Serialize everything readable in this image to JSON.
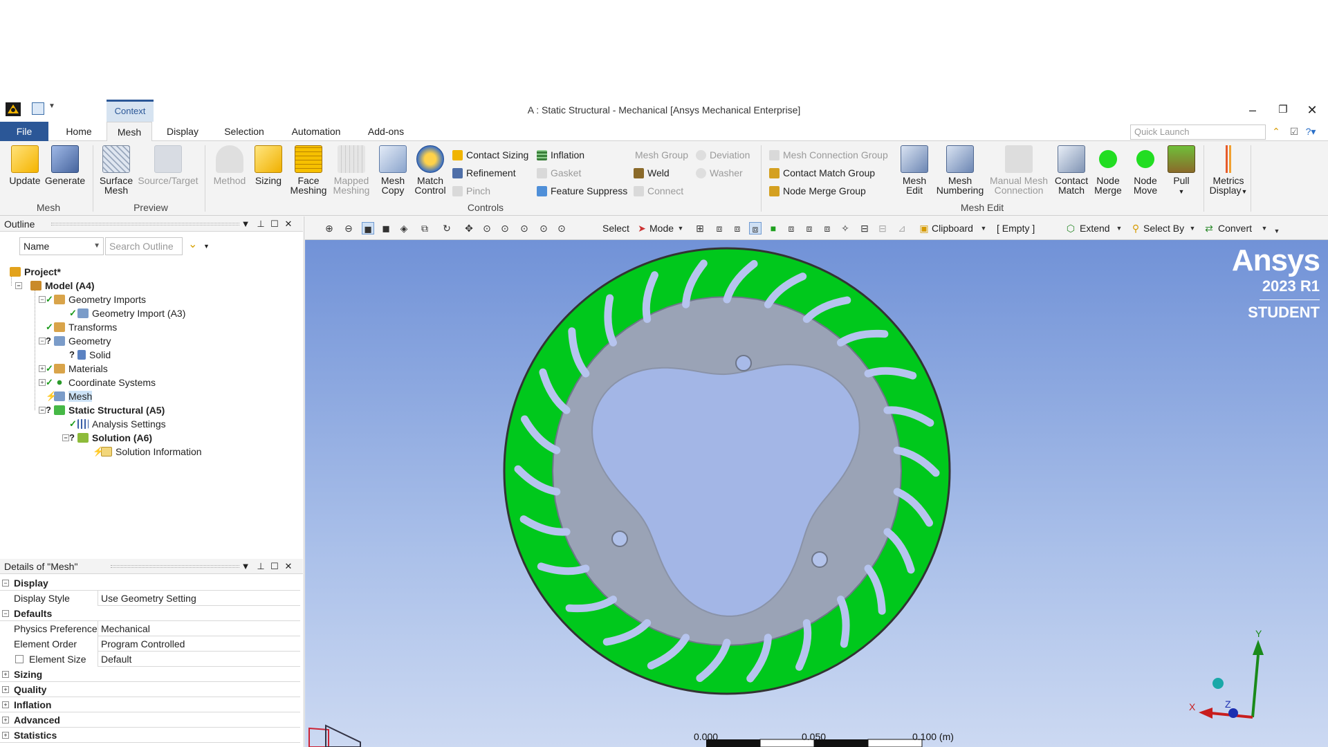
{
  "window": {
    "title": "A : Static Structural - Mechanical [Ansys Mechanical Enterprise]",
    "context_tab": "Context"
  },
  "tabs": {
    "file": "File",
    "items": [
      "Home",
      "Mesh",
      "Display",
      "Selection",
      "Automation",
      "Add-ons"
    ],
    "active": "Mesh",
    "quick_launch_placeholder": "Quick Launch"
  },
  "ribbon": {
    "update": "Update",
    "generate": "Generate",
    "mesh_group": "Mesh",
    "surface_mesh_1": "Surface",
    "surface_mesh_2": "Mesh",
    "source_target": "Source/Target",
    "preview_group": "Preview",
    "method": "Method",
    "sizing": "Sizing",
    "face_meshing_1": "Face",
    "face_meshing_2": "Meshing",
    "mapped_meshing_1": "Mapped",
    "mapped_meshing_2": "Meshing",
    "mesh_copy_1": "Mesh",
    "mesh_copy_2": "Copy",
    "match_control_1": "Match",
    "match_control_2": "Control",
    "contact_sizing": "Contact Sizing",
    "refinement": "Refinement",
    "pinch": "Pinch",
    "inflation": "Inflation",
    "gasket": "Gasket",
    "feature_suppress": "Feature Suppress",
    "controls_group": "Controls",
    "mesh_group_btn": "Mesh Group",
    "weld": "Weld",
    "connect": "Connect",
    "deviation": "Deviation",
    "washer": "Washer",
    "mesh_connection_group": "Mesh Connection Group",
    "contact_match_group": "Contact Match Group",
    "node_merge_group": "Node Merge Group",
    "mesh_edit_1": "Mesh",
    "mesh_edit_2": "Edit",
    "mesh_numbering_1": "Mesh",
    "mesh_numbering_2": "Numbering",
    "manual_mesh_connection_1": "Manual Mesh",
    "manual_mesh_connection_2": "Connection",
    "contact_match_1": "Contact",
    "contact_match_2": "Match",
    "node_merge_1": "Node",
    "node_merge_2": "Merge",
    "node_move_1": "Node",
    "node_move_2": "Move",
    "pull": "Pull",
    "mesh_edit_group": "Mesh Edit",
    "metrics_display_1": "Metrics",
    "metrics_display_2": "Display"
  },
  "outline": {
    "title": "Outline",
    "name_filter": "Name",
    "search_placeholder": "Search Outline",
    "tree": {
      "project": "Project*",
      "model": "Model (A4)",
      "geometry_imports": "Geometry Imports",
      "geometry_import": "Geometry Import (A3)",
      "transforms": "Transforms",
      "geometry": "Geometry",
      "solid": "Solid",
      "materials": "Materials",
      "coordinate_systems": "Coordinate Systems",
      "mesh": "Mesh",
      "static_structural": "Static Structural (A5)",
      "analysis_settings": "Analysis Settings",
      "solution": "Solution (A6)",
      "solution_information": "Solution Information"
    }
  },
  "details": {
    "title": "Details of \"Mesh\"",
    "display_group": "Display",
    "display_style_key": "Display Style",
    "display_style_val": "Use Geometry Setting",
    "defaults_group": "Defaults",
    "physics_preference_key": "Physics Preference",
    "physics_preference_val": "Mechanical",
    "element_order_key": "Element Order",
    "element_order_val": "Program Controlled",
    "element_size_key": "Element Size",
    "element_size_val": "Default",
    "sizing_group": "Sizing",
    "quality_group": "Quality",
    "inflation_group": "Inflation",
    "advanced_group": "Advanced",
    "statistics_group": "Statistics"
  },
  "graphics_toolbar": {
    "select": "Select",
    "mode": "Mode",
    "clipboard": "Clipboard",
    "empty": "[ Empty ]",
    "extend": "Extend",
    "select_by": "Select By",
    "convert": "Convert"
  },
  "viewport": {
    "brand": "Ansys",
    "version": "2023 R1",
    "edition": "STUDENT",
    "scale_0": "0.000",
    "scale_1": "0.050",
    "scale_2": "0.100 (m)",
    "axis_x": "X",
    "axis_y": "Y",
    "axis_z": "Z",
    "mesh_color": "#00c81c",
    "body_color": "#9aa3b6"
  }
}
